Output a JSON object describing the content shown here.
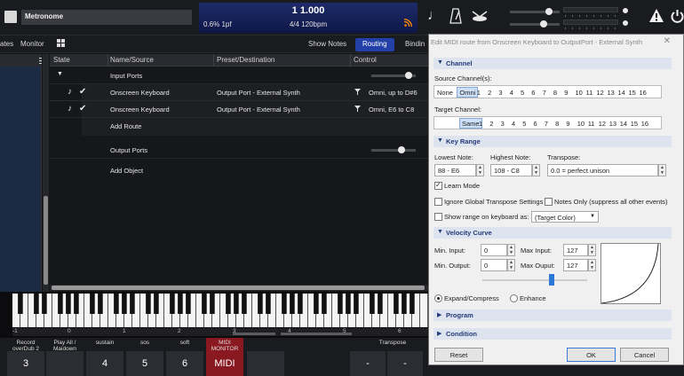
{
  "topbar": {
    "song_name": "Metronome",
    "transport_position": "1 1.000",
    "transport_left": "0.6%  1pf",
    "transport_tempo": "4/4 120bpm"
  },
  "tabs": {
    "states": "ates",
    "monitor": "Monitor",
    "show_notes": "Show Notes",
    "routing": "Routing",
    "bindings": "Bindin"
  },
  "table": {
    "headers": [
      "State",
      "Name/Source",
      "Preset/Destination",
      "Control"
    ],
    "input_ports_label": "Input Ports",
    "routes": [
      {
        "source": "Onscreen Keyboard",
        "destination": "Output Port - External Synth",
        "control": "Omni, up to D#6"
      },
      {
        "source": "Onscreen Keyboard",
        "destination": "Output Port - External Synth",
        "control": "Omni, E6 to C8"
      }
    ],
    "add_route": "Add Route",
    "output_ports_label": "Output Ports",
    "add_object": "Add Object"
  },
  "keyboard": {
    "octave_labels": [
      "-1",
      "0",
      "1",
      "2",
      "3",
      "4",
      "5",
      "6",
      "7"
    ]
  },
  "bottom_buttons": [
    {
      "label": "Record\noverDub 2",
      "value": "3"
    },
    {
      "label": "Play All /\nMaidown",
      "value": ""
    },
    {
      "label": "sustain",
      "value": "4"
    },
    {
      "label": "sos",
      "value": "5"
    },
    {
      "label": "soft",
      "value": "6"
    },
    {
      "label": "MIDI\nMONITOR",
      "value": "MIDI"
    },
    {
      "label": "Transpose",
      "value": ""
    }
  ],
  "dialog": {
    "title": "Edit MIDI route from Onscreen Keyboard to OutputPort - External Synth",
    "close": "✕",
    "channel": {
      "section": "Channel",
      "source_label": "Source Channel(s):",
      "source_options": [
        "None",
        "Omni",
        "1",
        "2",
        "3",
        "4",
        "5",
        "6",
        "7",
        "8",
        "9",
        "10",
        "11",
        "12",
        "13",
        "14",
        "15",
        "16"
      ],
      "source_selected": "Omni",
      "target_label": "Target Channel:",
      "target_options": [
        "Same",
        "1",
        "2",
        "3",
        "4",
        "5",
        "6",
        "7",
        "8",
        "9",
        "10",
        "11",
        "12",
        "13",
        "14",
        "15",
        "16"
      ],
      "target_selected": "Same"
    },
    "key_range": {
      "section": "Key Range",
      "lowest_label": "Lowest Note:",
      "lowest_value": "88 - E6",
      "highest_label": "Highest Note:",
      "highest_value": "108 - C8",
      "transpose_label": "Transpose:",
      "transpose_value": "0.0 = perfect unison",
      "learn_mode": "Learn Mode",
      "learn_mode_checked": true,
      "ignore_global": "Ignore Global Transpose Settings",
      "notes_only": "Notes Only (suppress all other events)",
      "show_range": "Show range on keyboard as:",
      "show_range_value": "(Target Color)"
    },
    "velocity": {
      "section": "Velocity Curve",
      "min_input_label": "Min. Input:",
      "min_input": "0",
      "max_input_label": "Max Input:",
      "max_input": "127",
      "min_output_label": "Min. Output:",
      "min_output": "0",
      "max_output_label": "Max Ouput:",
      "max_output": "127",
      "expand": "Expand/Compress",
      "enhance": "Enhance"
    },
    "program": {
      "section": "Program"
    },
    "condition": {
      "section": "Condition"
    },
    "buttons": {
      "reset": "Reset",
      "ok": "OK",
      "cancel": "Cancel"
    }
  }
}
